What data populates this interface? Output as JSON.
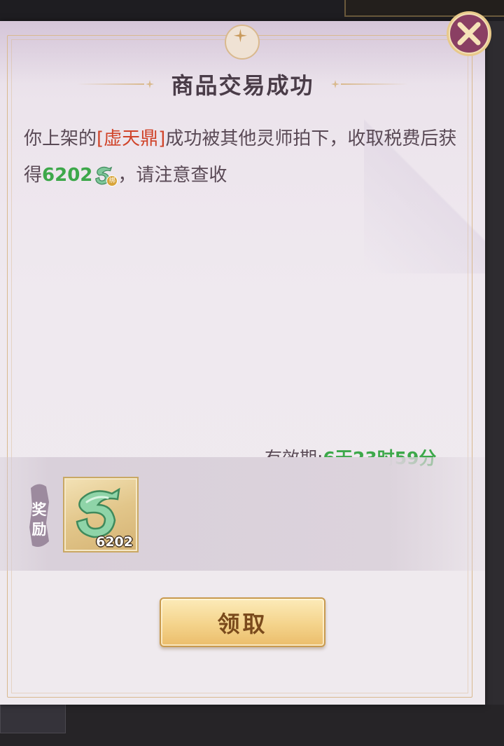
{
  "dialog": {
    "title": "商品交易成功",
    "message": {
      "prefix": "你上架的",
      "item_name": "[虚天鼎]",
      "middle": "成功被其他灵师拍下，收取税费后获得",
      "amount": "6202",
      "currency_badge": "绑",
      "suffix": "，请注意查收"
    },
    "validity": {
      "label": "有效期:",
      "time": "6天23时59分"
    },
    "reward": {
      "tag_label": "奖励",
      "items": [
        {
          "icon": "jade-currency-icon",
          "quantity": "6202"
        }
      ]
    },
    "claim_button_label": "领取",
    "close_icon": "close-x-icon"
  },
  "colors": {
    "item_name": "#d0442a",
    "amount": "#3da84a",
    "title": "#4a3c48",
    "button_text": "#7a4a1c",
    "frame": "#d9b98e"
  }
}
